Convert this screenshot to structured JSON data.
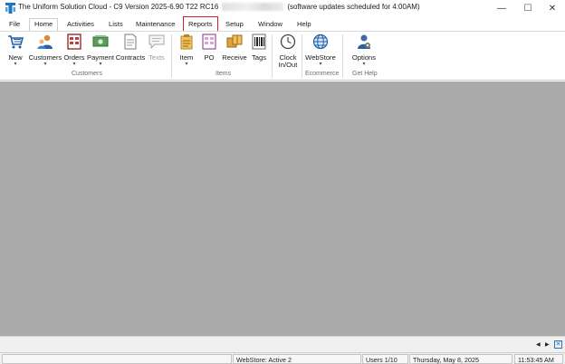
{
  "window": {
    "title_main": "The Uniform Solution Cloud - C9 Version 2025-6.90 T22 RC16",
    "title_suffix": "(software updates scheduled for  4:00AM)",
    "minimize_glyph": "—",
    "maximize_glyph": "☐",
    "close_glyph": "✕"
  },
  "menu": {
    "items": [
      {
        "label": "File"
      },
      {
        "label": "Home"
      },
      {
        "label": "Activities"
      },
      {
        "label": "Lists"
      },
      {
        "label": "Maintenance"
      },
      {
        "label": "Reports"
      },
      {
        "label": "Setup"
      },
      {
        "label": "Window"
      },
      {
        "label": "Help"
      }
    ],
    "active": "Home",
    "highlighted": "Reports",
    "highlight_color": "#d41e2a"
  },
  "ribbon": {
    "buttons": [
      {
        "label": "New",
        "icon": "cart-icon",
        "caret": "▾"
      },
      {
        "label": "Customers",
        "icon": "customers-icon",
        "caret": "▾"
      },
      {
        "label": "Orders",
        "icon": "orders-icon",
        "caret": "▾"
      },
      {
        "label": "Payment",
        "icon": "payment-icon",
        "caret": "▾"
      },
      {
        "label": "Contracts",
        "icon": "contracts-icon",
        "caret": ""
      },
      {
        "label": "Texts",
        "icon": "texts-icon",
        "caret": ""
      },
      {
        "label": "Item",
        "icon": "item-icon",
        "caret": "▾"
      },
      {
        "label": "PO",
        "icon": "po-icon",
        "caret": ""
      },
      {
        "label": "Receive",
        "icon": "receive-icon",
        "caret": ""
      },
      {
        "label": "Tags",
        "icon": "tags-icon",
        "caret": ""
      },
      {
        "label": "Clock",
        "label2": "In/Out",
        "icon": "clock-icon",
        "caret": ""
      },
      {
        "label": "WebStore",
        "icon": "globe-icon",
        "caret": "▾"
      },
      {
        "label": "Options",
        "icon": "options-icon",
        "caret": "▾"
      }
    ],
    "groups": [
      {
        "label": "Customers"
      },
      {
        "label": "Items"
      },
      {
        "label": "Ecommerce"
      },
      {
        "label": "Get Help"
      }
    ]
  },
  "workspace": {
    "background": "#ababab"
  },
  "nav": {
    "prev": "◀",
    "next": "▶",
    "close": "✕"
  },
  "statusbar": {
    "webstore": "WebStore:  Active 2",
    "users": "Users 1/10",
    "date": "Thursday, May  8, 2025",
    "time": "11:53:45 AM"
  }
}
